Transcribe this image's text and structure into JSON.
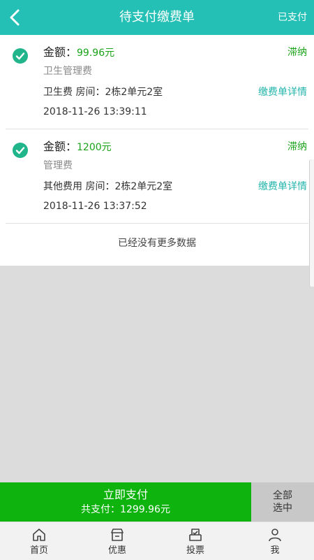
{
  "header": {
    "title": "待支付缴费单",
    "right_label": "已支付",
    "back_icon": "chevron-left-icon"
  },
  "bills": [
    {
      "amount_label": "金额：",
      "amount": "99.96元",
      "status": "滞纳",
      "type": "卫生管理费",
      "room": "卫生费 房间：2栋2单元2室",
      "detail_label": "缴费单详情",
      "time": "2018-11-26 13:39:11",
      "checked": true
    },
    {
      "amount_label": "金额：",
      "amount": "1200元",
      "status": "滞纳",
      "type": "管理费",
      "room": "其他费用 房间：2栋2单元2室",
      "detail_label": "缴费单详情",
      "time": "2018-11-26 13:37:52",
      "checked": true
    }
  ],
  "no_more": "已经没有更多数据",
  "pay": {
    "button_label": "立即支付",
    "total": "共支付：1299.96元",
    "select_all_line1": "全部",
    "select_all_line2": "选中"
  },
  "tabs": [
    {
      "label": "首页",
      "icon": "home-icon"
    },
    {
      "label": "优惠",
      "icon": "shop-icon"
    },
    {
      "label": "投票",
      "icon": "ballot-icon"
    },
    {
      "label": "我",
      "icon": "user-icon"
    }
  ],
  "colors": {
    "header": "#24c0b5",
    "pay_button": "#0eb30e",
    "amount": "#1aa31a",
    "detail_link": "#24b5ac",
    "check": "#20b58a"
  }
}
